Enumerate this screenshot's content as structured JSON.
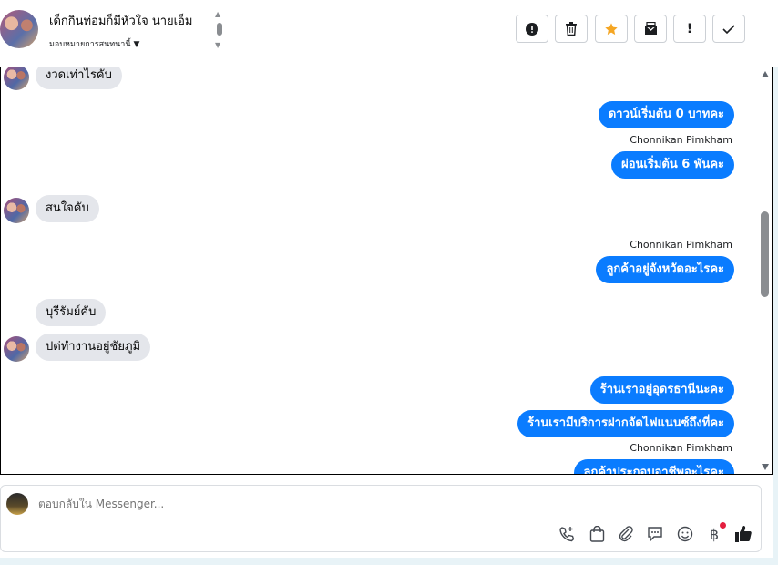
{
  "header": {
    "contact_name": "เด็กกินท่อมก็มีหัวใจ นายเอ็ม",
    "assign_label": "มอบหมายการสนทนานี้",
    "actions": [
      {
        "name": "report-button",
        "icon": "exclamation-circle-icon",
        "glyph": "!"
      },
      {
        "name": "delete-button",
        "icon": "trash-icon",
        "glyph": ""
      },
      {
        "name": "star-button",
        "icon": "star-icon",
        "glyph": "★"
      },
      {
        "name": "mark-unread-button",
        "icon": "envelope-icon",
        "glyph": ""
      },
      {
        "name": "flag-button",
        "icon": "exclamation-icon",
        "glyph": "!"
      },
      {
        "name": "done-button",
        "icon": "check-icon",
        "glyph": "✓"
      }
    ]
  },
  "messages": [
    {
      "side": "in",
      "text": "งวดเท่าไรคับ",
      "avatar": true
    },
    {
      "side": "out",
      "text": "ดาวน์เริ่มต้น 0 บาทคะ"
    },
    {
      "side": "sender",
      "text": "Chonnikan Pimkham"
    },
    {
      "side": "out",
      "text": "ผ่อนเริ่มต้น 6 พันคะ"
    },
    {
      "side": "in",
      "text": "สนใจคับ",
      "avatar": true
    },
    {
      "side": "sender",
      "text": "Chonnikan Pimkham"
    },
    {
      "side": "out",
      "text": "ลูกค้าอยู่จังหวัดอะไรคะ"
    },
    {
      "side": "in",
      "text": "บุรีรัมย์คับ"
    },
    {
      "side": "in",
      "text": "ปต่ทำงานอยู่ชัยภูมิ",
      "avatar": true
    },
    {
      "side": "out",
      "text": "ร้านเราอยู่อุดรธานีนะคะ"
    },
    {
      "side": "out",
      "text": "ร้านเรามีบริการฝากจัดไฟแนนซ์ถึงที่คะ"
    },
    {
      "side": "sender",
      "text": "Chonnikan Pimkham"
    },
    {
      "side": "out",
      "text": "ลูกค้าประกอบอาชีพอะไรคะ"
    }
  ],
  "composer": {
    "placeholder": "ตอบกลับใน Messenger...",
    "icons": [
      "phone-add-icon",
      "shopping-bag-icon",
      "paperclip-icon",
      "chat-bubble-icon",
      "smiley-icon",
      "baht-icon",
      "thumbs-up-icon"
    ]
  },
  "colors": {
    "accent": "#0a7cff",
    "incoming_bubble": "#e4e6eb",
    "star": "#f5a623",
    "notification": "#e41e3f"
  }
}
